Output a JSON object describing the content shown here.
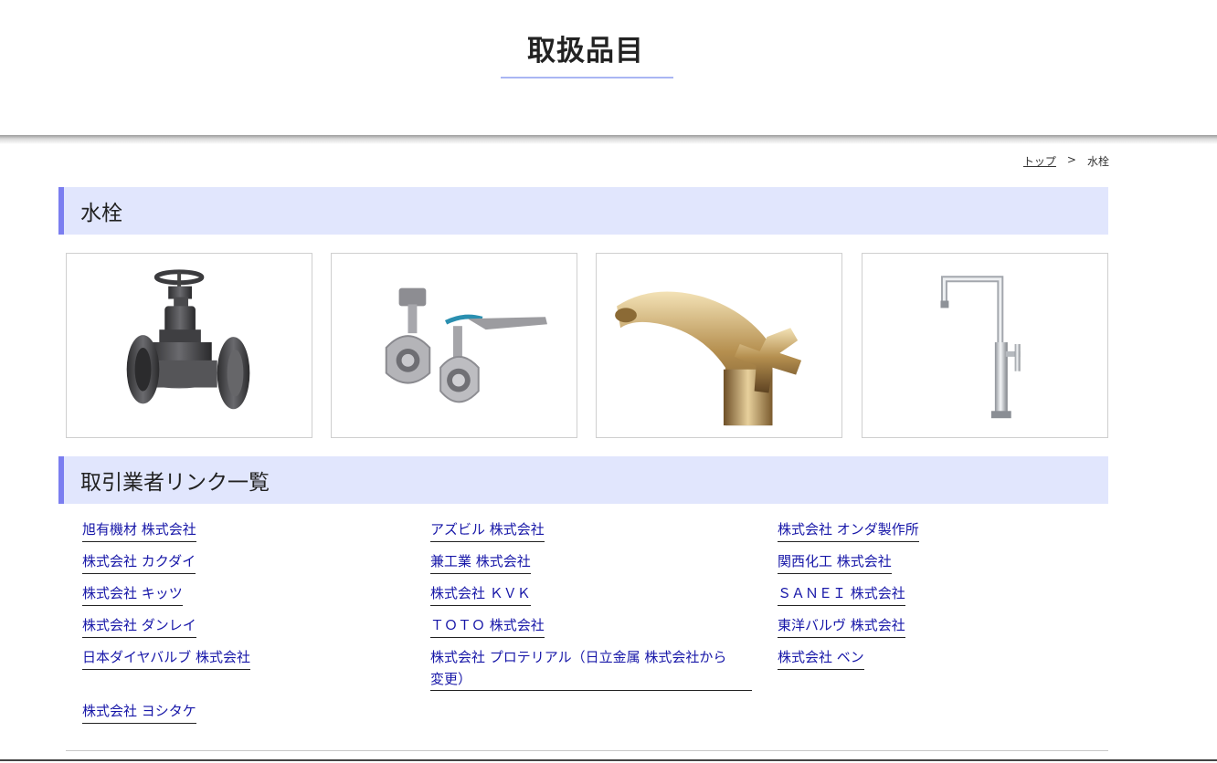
{
  "header": {
    "title": "取扱品目"
  },
  "breadcrumb": {
    "home": "トップ",
    "separator": ">",
    "current": "水栓"
  },
  "section1": {
    "title": "水栓"
  },
  "products": [
    {
      "icon": "gate-valve-image"
    },
    {
      "icon": "butterfly-valve-image"
    },
    {
      "icon": "gold-faucet-image"
    },
    {
      "icon": "chrome-faucet-image"
    }
  ],
  "section2": {
    "title": "取引業者リンク一覧"
  },
  "vendors": [
    "旭有機材 株式会社",
    "アズビル 株式会社",
    "株式会社 オンダ製作所",
    "株式会社 カクダイ",
    "兼工業 株式会社",
    "関西化工 株式会社",
    "株式会社 キッツ",
    "株式会社 ＫＶＫ",
    "ＳＡＮＥＩ 株式会社",
    "株式会社 ダンレイ",
    "ＴＯＴＯ 株式会社",
    "東洋バルヴ 株式会社",
    "日本ダイヤバルブ 株式会社",
    "株式会社 プロテリアル（日立金属 株式会社から",
    "変更）",
    "株式会社 ベン",
    "株式会社 ヨシタケ"
  ],
  "colors": {
    "accent": "#7b7ef0",
    "section_bg": "#e1e6fd",
    "link": "#1717a8",
    "underline": "#a9b6f3"
  }
}
